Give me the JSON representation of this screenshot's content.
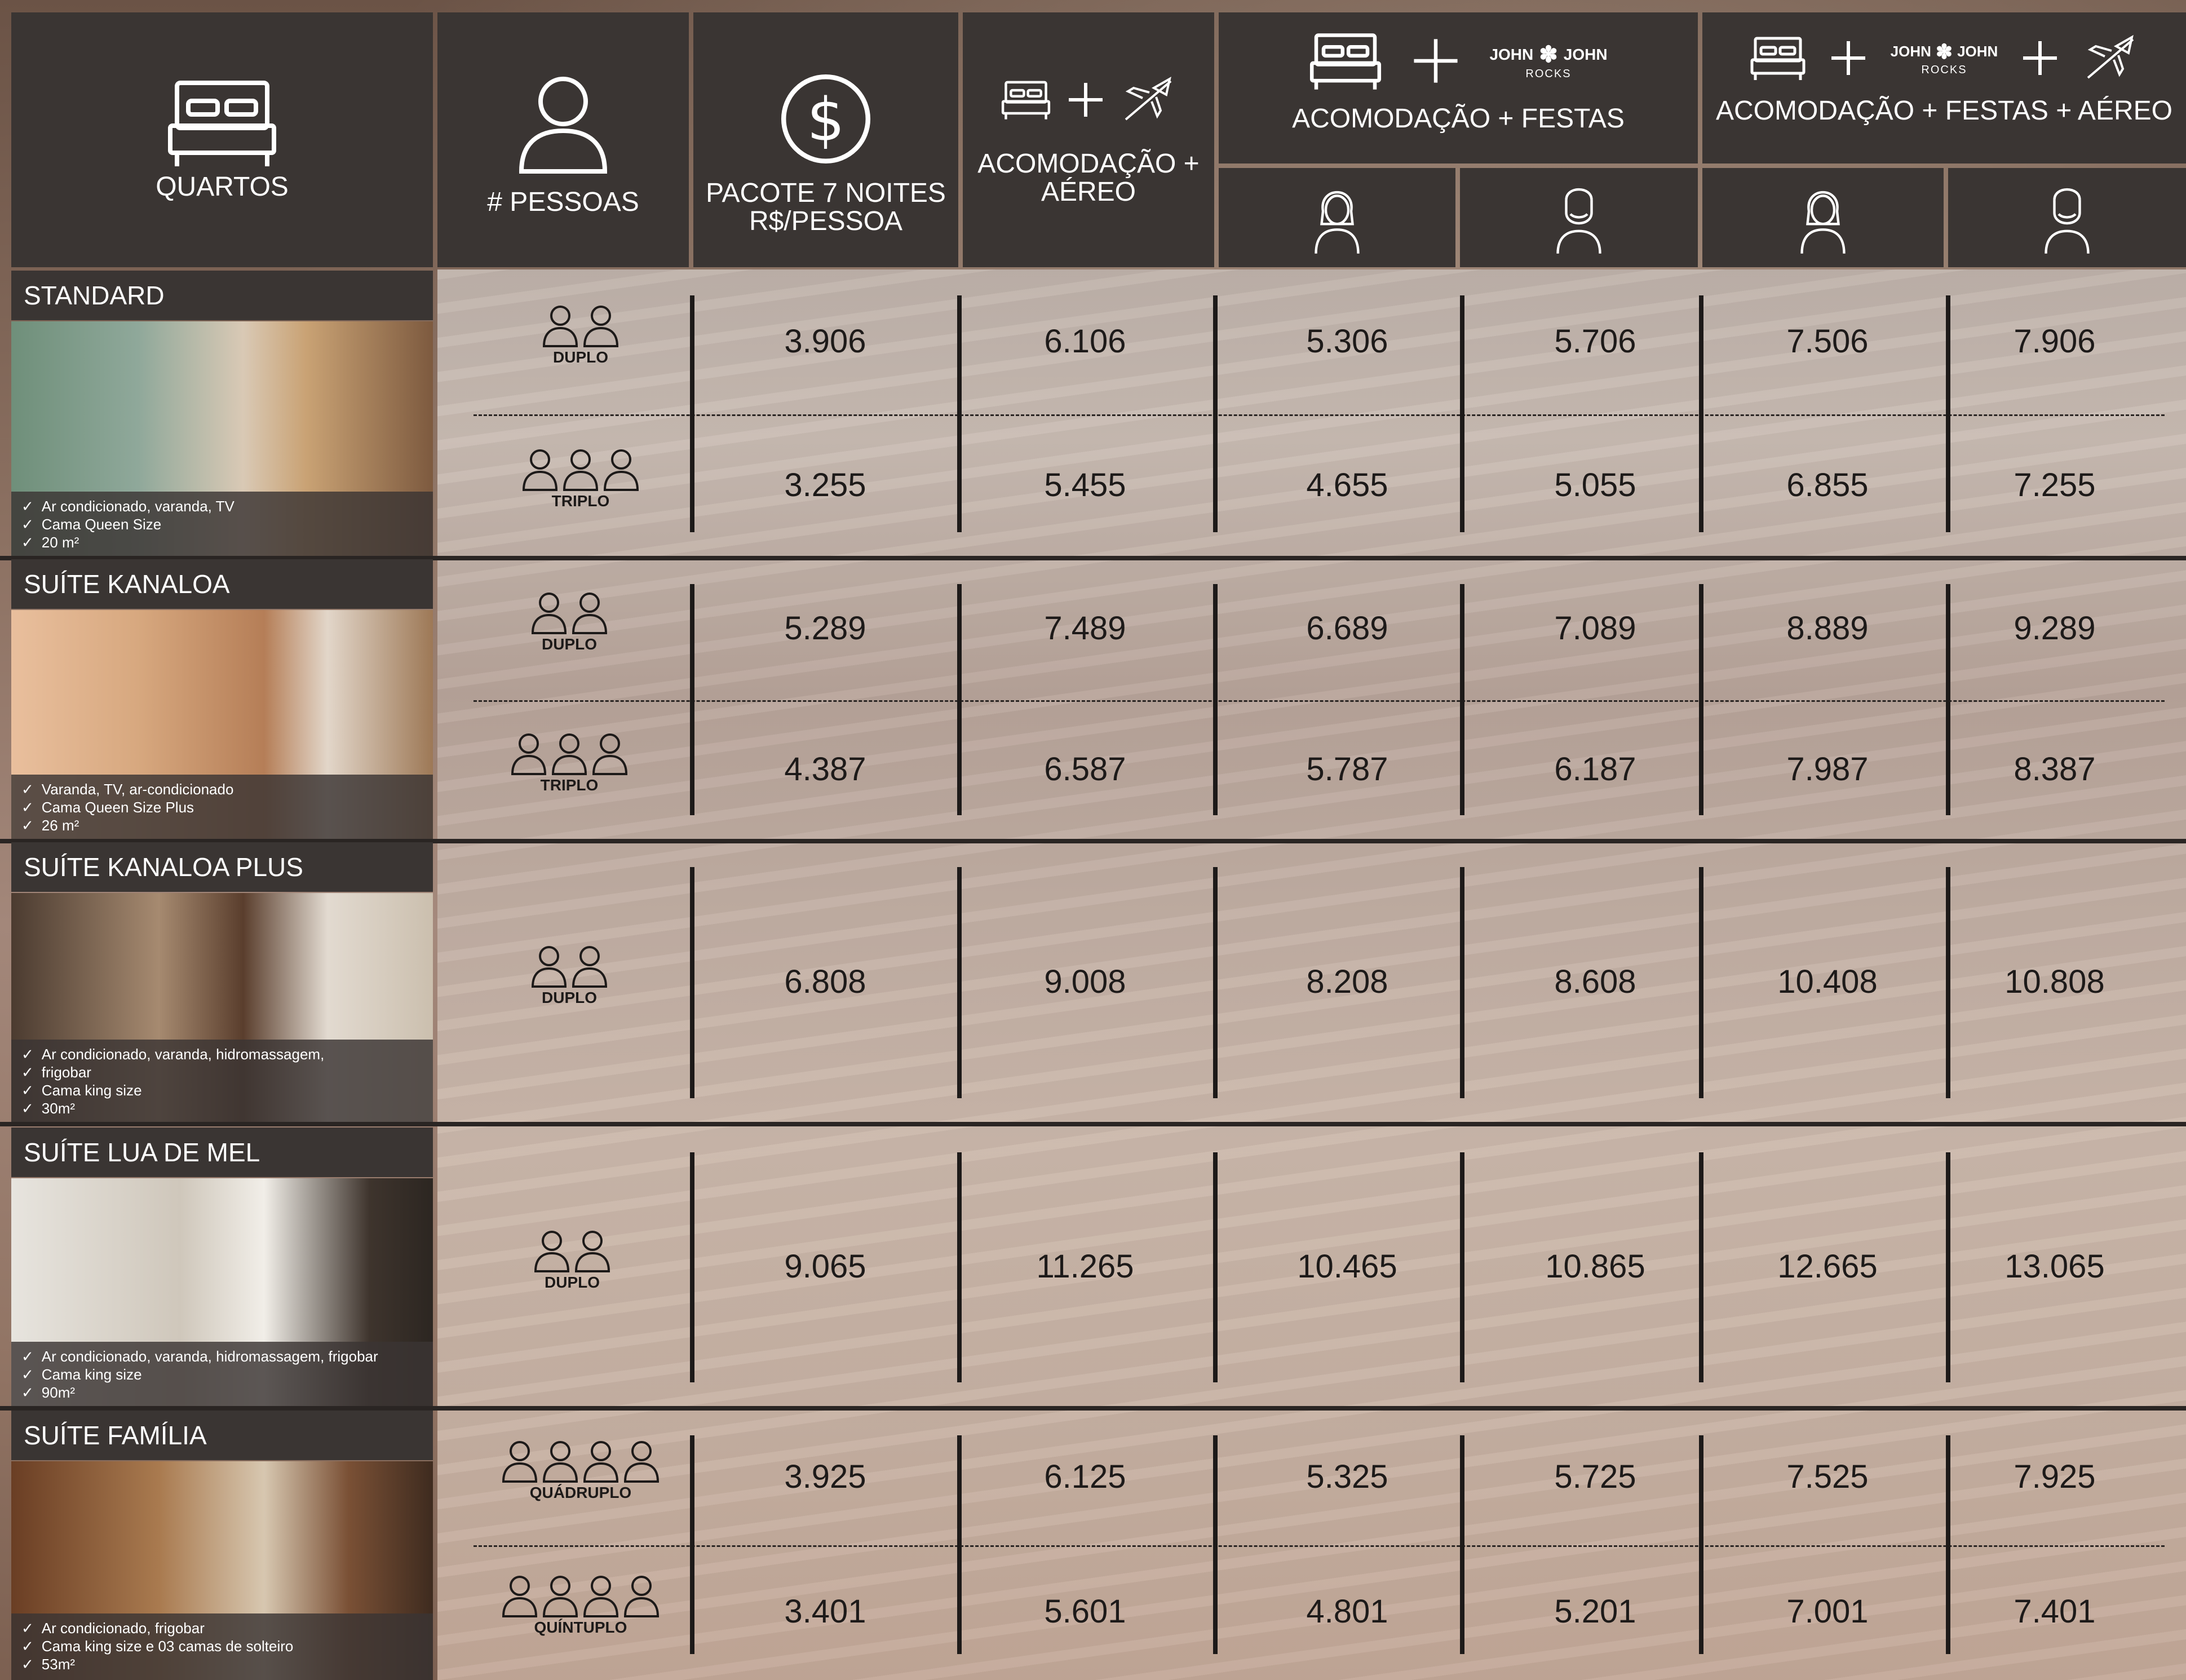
{
  "header": {
    "rooms_label": "QUARTOS",
    "persons_label": "# PESSOAS",
    "package_label_1": "PACOTE 7 NOITES",
    "package_label_2": "R$/PESSOA",
    "acc_air_label_1": "ACOMODAÇÃO +",
    "acc_air_label_2": "AÉREO",
    "acc_parties_label": "ACOMODAÇÃO + FESTAS",
    "acc_parties_air_label": "ACOMODAÇÃO + FESTAS + AÉREO",
    "brand_left": "JOHN",
    "brand_right": "JOHN",
    "brand_sub": "ROCKS"
  },
  "rooms": [
    {
      "name": "STANDARD",
      "features": [
        "Ar condicionado, varanda, TV",
        "Cama Queen Size",
        "20 m²"
      ],
      "rows": [
        {
          "occupancy": "DUPLO",
          "icons": 2,
          "prices": [
            "3.906",
            "6.106",
            "5.306",
            "5.706",
            "7.506",
            "7.906"
          ]
        },
        {
          "occupancy": "TRIPLO",
          "icons": 3,
          "prices": [
            "3.255",
            "5.455",
            "4.655",
            "5.055",
            "6.855",
            "7.255"
          ]
        }
      ]
    },
    {
      "name": "SUÍTE KANALOA",
      "features": [
        "Varanda, TV, ar-condicionado",
        "Cama Queen Size Plus",
        "26 m²"
      ],
      "rows": [
        {
          "occupancy": "DUPLO",
          "icons": 2,
          "prices": [
            "5.289",
            "7.489",
            "6.689",
            "7.089",
            "8.889",
            "9.289"
          ]
        },
        {
          "occupancy": "TRIPLO",
          "icons": 3,
          "prices": [
            "4.387",
            "6.587",
            "5.787",
            "6.187",
            "7.987",
            "8.387"
          ]
        }
      ]
    },
    {
      "name": "SUÍTE KANALOA PLUS",
      "features": [
        "Ar condicionado, varanda, hidromassagem,",
        "frigobar",
        "Cama king size",
        "30m²"
      ],
      "rows": [
        {
          "occupancy": "DUPLO",
          "icons": 2,
          "prices": [
            "6.808",
            "9.008",
            "8.208",
            "8.608",
            "10.408",
            "10.808"
          ]
        }
      ]
    },
    {
      "name": "SUÍTE LUA DE MEL",
      "features": [
        "Ar condicionado, varanda, hidromassagem, frigobar",
        "Cama king size",
        "90m²"
      ],
      "rows": [
        {
          "occupancy": "DUPLO",
          "icons": 2,
          "prices": [
            "9.065",
            "11.265",
            "10.465",
            "10.865",
            "12.665",
            "13.065"
          ]
        }
      ]
    },
    {
      "name": "SUÍTE FAMÍLIA",
      "features": [
        "Ar condicionado, frigobar",
        "Cama king size e 03 camas de solteiro",
        "53m²"
      ],
      "rows": [
        {
          "occupancy": "QUÁDRUPLO",
          "icons": 4,
          "prices": [
            "3.925",
            "6.125",
            "5.325",
            "5.725",
            "7.525",
            "7.925"
          ]
        },
        {
          "occupancy": "QUÍNTUPLO",
          "icons": 4,
          "prices": [
            "3.401",
            "5.601",
            "4.801",
            "5.201",
            "7.001",
            "7.401"
          ]
        }
      ]
    }
  ]
}
